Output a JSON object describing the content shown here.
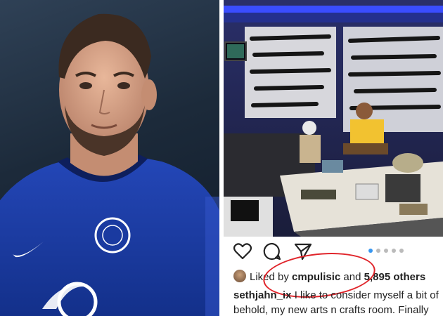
{
  "post": {
    "liked_by_prefix": "Liked by",
    "liked_by_user": "cmpulisic",
    "liked_by_and": "and",
    "others_count": "5,895 others",
    "caption_user": "sethjahn_ix",
    "caption_line1": "I like to consider myself a bit of",
    "caption_line2": "behold, my new arts n crafts room. Finally"
  },
  "carousel": {
    "total_dots": 5,
    "active_index": 0
  },
  "icons": {
    "like": "heart-icon",
    "comment": "comment-icon",
    "share": "send-icon"
  },
  "colors": {
    "annotation_circle": "#e0242a",
    "jersey": "#1e3fa3",
    "room_light": "#3a4dff"
  }
}
